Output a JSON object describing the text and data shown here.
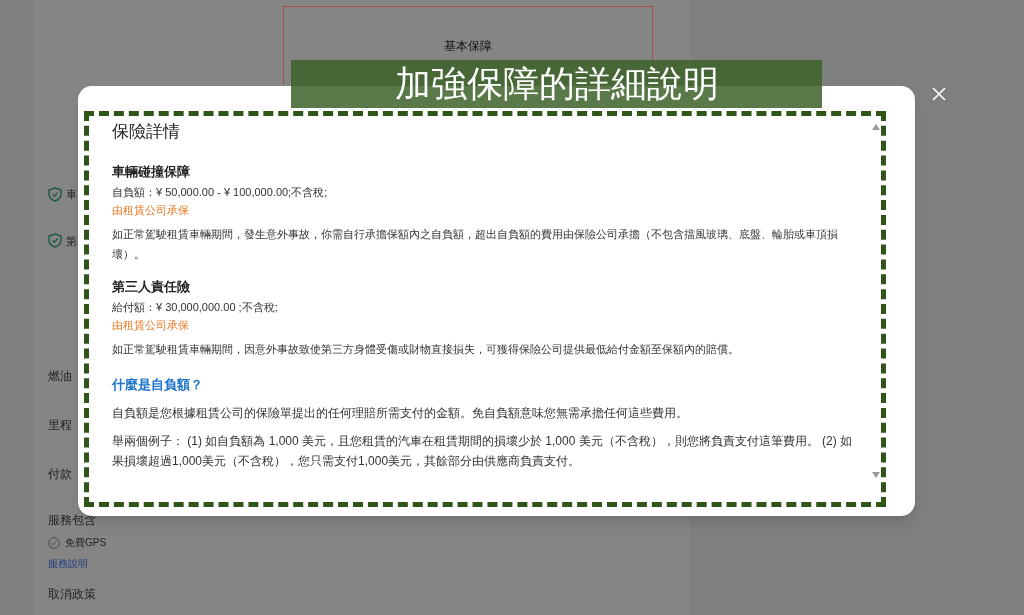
{
  "background": {
    "plan_header": "基本保障",
    "coverage_items": [
      "車",
      "第"
    ],
    "rows": [
      "燃油",
      "里程",
      "付款"
    ],
    "services": {
      "title": "服務包含",
      "items": [
        "免費GPS"
      ],
      "link": "服務說明"
    },
    "cancellation": {
      "title": "取消政策"
    }
  },
  "banner": {
    "text": "加強保障的詳細說明"
  },
  "modal": {
    "title": "保險詳情",
    "coverages": [
      {
        "name": "車輛碰撞保障",
        "amount": "自負額：¥ 50,000.00 - ¥ 100,000.00;不含稅;",
        "provider": "由租賃公司承保",
        "description": "如正常駕駛租賃車輛期間，發生意外事故，你需自行承擔保額內之自負額，超出自負額的費用由保險公司承擔（不包含擋風玻璃、底盤、輪胎或車頂損壞）。"
      },
      {
        "name": "第三人責任險",
        "amount": "給付額：¥ 30,000,000.00 ;不含稅;",
        "provider": "由租賃公司承保",
        "description": "如正常駕駛租賃車輛期間，因意外事故致使第三方身體受傷或財物直接損失，可獲得保險公司提供最低給付金額至保額內的賠償。"
      }
    ],
    "faq": {
      "question": "什麼是自負額？",
      "paragraphs": [
        "自負額是您根據租賃公司的保險單提出的任何理賠所需支付的金額。免自負額意味您無需承擔任何這些費用。",
        "舉兩個例子： (1) 如自負額為 1,000 美元，且您租賃的汽車在租賃期間的損壞少於 1,000 美元（不含稅），則您將負責支付這筆費用。 (2) 如果損壞超過1,000美元（不含稅），您只需支付1,000美元，其餘部分由供應商負責支付。"
      ]
    }
  }
}
